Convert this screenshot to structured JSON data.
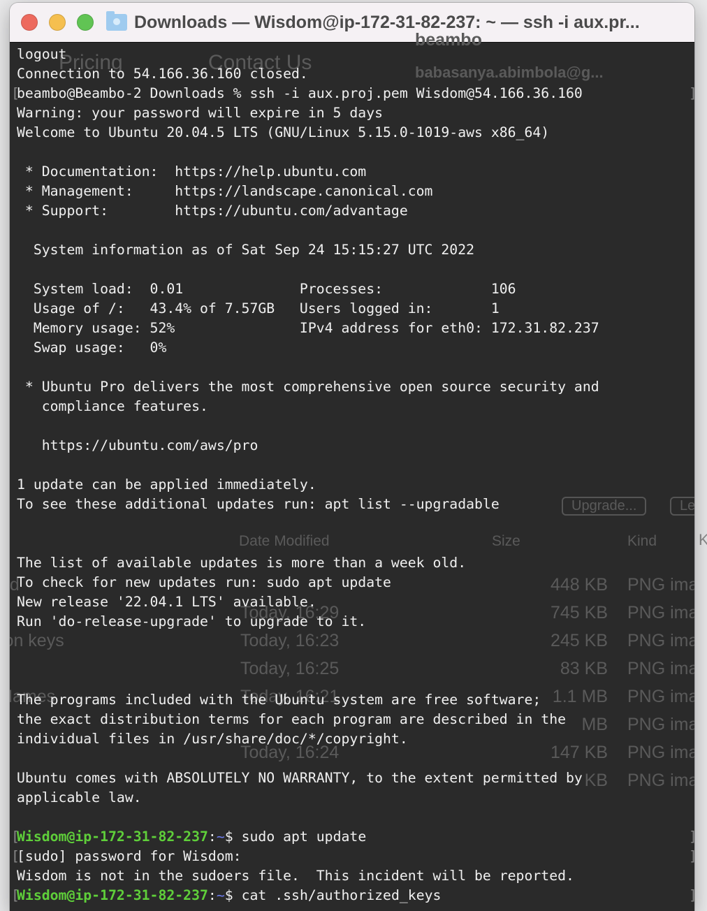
{
  "window": {
    "title": "Downloads — Wisdom@ip-172-31-82-237: ~ — ssh -i aux.pr..."
  },
  "background": {
    "texts": [
      "Pricing",
      "Contact Us",
      "beambo",
      "babasanya.abimbola@g...",
      "Upgrade...",
      "Lear",
      "Date Modified",
      "Size",
      "Kind",
      "nd",
      "1",
      "ion keys",
      "Names"
    ],
    "file_rows": [
      {
        "date": "",
        "size": "448 KB",
        "kind": "PNG imag"
      },
      {
        "date": "Today, 16:29",
        "size": "745 KB",
        "kind": "PNG imag"
      },
      {
        "date": "Today, 16:23",
        "size": "245 KB",
        "kind": "PNG imag"
      },
      {
        "date": "Today, 16:25",
        "size": "83 KB",
        "kind": "PNG imag"
      },
      {
        "date": "Today, 16:21",
        "size": "1.1 MB",
        "kind": "PNG imag"
      },
      {
        "date": "",
        "size": "MB",
        "kind": "PNG imag"
      },
      {
        "date": "Today, 16:24",
        "size": "147 KB",
        "kind": "PNG imag"
      },
      {
        "date": "",
        "size": "KB",
        "kind": "PNG imag"
      }
    ]
  },
  "terminal": {
    "lines": [
      {
        "text": "logout"
      },
      {
        "text": "Connection to 54.166.36.160 closed."
      },
      {
        "text": "beambo@Beambo-2 Downloads % ssh -i aux.proj.pem Wisdom@54.166.36.160",
        "mark": true
      },
      {
        "text": "Warning: your password will expire in 5 days"
      },
      {
        "text": "Welcome to Ubuntu 20.04.5 LTS (GNU/Linux 5.15.0-1019-aws x86_64)"
      },
      {
        "text": ""
      },
      {
        "text": " * Documentation:  https://help.ubuntu.com"
      },
      {
        "text": " * Management:     https://landscape.canonical.com"
      },
      {
        "text": " * Support:        https://ubuntu.com/advantage"
      },
      {
        "text": ""
      },
      {
        "text": "  System information as of Sat Sep 24 15:15:27 UTC 2022"
      },
      {
        "text": ""
      },
      {
        "text": "  System load:  0.01              Processes:             106"
      },
      {
        "text": "  Usage of /:   43.4% of 7.57GB   Users logged in:       1"
      },
      {
        "text": "  Memory usage: 52%               IPv4 address for eth0: 172.31.82.237"
      },
      {
        "text": "  Swap usage:   0%"
      },
      {
        "text": ""
      },
      {
        "text": " * Ubuntu Pro delivers the most comprehensive open source security and"
      },
      {
        "text": "   compliance features."
      },
      {
        "text": ""
      },
      {
        "text": "   https://ubuntu.com/aws/pro"
      },
      {
        "text": ""
      },
      {
        "text": "1 update can be applied immediately."
      },
      {
        "text": "To see these additional updates run: apt list --upgradable"
      },
      {
        "text": ""
      },
      {
        "text": ""
      },
      {
        "text": "The list of available updates is more than a week old."
      },
      {
        "text": "To check for new updates run: sudo apt update"
      },
      {
        "text": "New release '22.04.1 LTS' available."
      },
      {
        "text": "Run 'do-release-upgrade' to upgrade to it."
      },
      {
        "text": ""
      },
      {
        "text": ""
      },
      {
        "text": ""
      },
      {
        "text": "The programs included with the Ubuntu system are free software;"
      },
      {
        "text": "the exact distribution terms for each program are described in the"
      },
      {
        "text": "individual files in /usr/share/doc/*/copyright."
      },
      {
        "text": ""
      },
      {
        "text": "Ubuntu comes with ABSOLUTELY NO WARRANTY, to the extent permitted by"
      },
      {
        "text": "applicable law."
      },
      {
        "text": ""
      },
      {
        "prompt": {
          "user": "Wisdom@ip-172-31-82-237",
          "sep": ":",
          "dir": "~",
          "sym": "$ ",
          "cmd": "sudo apt update"
        },
        "mark": true
      },
      {
        "text": "[sudo] password for Wisdom:",
        "mark": true
      },
      {
        "text": "Wisdom is not in the sudoers file.  This incident will be reported."
      },
      {
        "prompt": {
          "user": "Wisdom@ip-172-31-82-237",
          "sep": ":",
          "dir": "~",
          "sym": "$ ",
          "cmd": "cat .ssh/authorized_keys"
        },
        "mark": true
      }
    ]
  },
  "colors": {
    "prompt_user": "#5fcf3a",
    "prompt_dir": "#6e7cf0",
    "terminal_bg": "#1e1e1e"
  }
}
